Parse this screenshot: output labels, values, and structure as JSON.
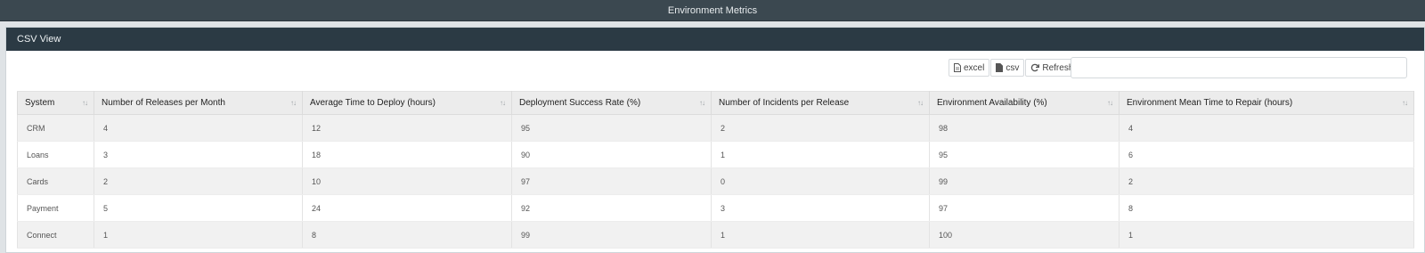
{
  "app": {
    "title": "Environment Metrics"
  },
  "panel": {
    "title": "CSV View"
  },
  "toolbar": {
    "excel_label": "excel",
    "csv_label": "csv",
    "refresh_label": "Refresh",
    "search_value": "",
    "search_placeholder": ""
  },
  "table": {
    "headers": [
      "System",
      "Number of Releases per Month",
      "Average Time to Deploy (hours)",
      "Deployment Success Rate (%)",
      "Number of Incidents per Release",
      "Environment Availability (%)",
      "Environment Mean Time to Repair (hours)"
    ],
    "rows": [
      [
        "CRM",
        "4",
        "12",
        "95",
        "2",
        "98",
        "4"
      ],
      [
        "Loans",
        "3",
        "18",
        "90",
        "1",
        "95",
        "6"
      ],
      [
        "Cards",
        "2",
        "10",
        "97",
        "0",
        "99",
        "2"
      ],
      [
        "Payment",
        "5",
        "24",
        "92",
        "3",
        "97",
        "8"
      ],
      [
        "Connect",
        "1",
        "8",
        "99",
        "1",
        "100",
        "1"
      ]
    ]
  }
}
